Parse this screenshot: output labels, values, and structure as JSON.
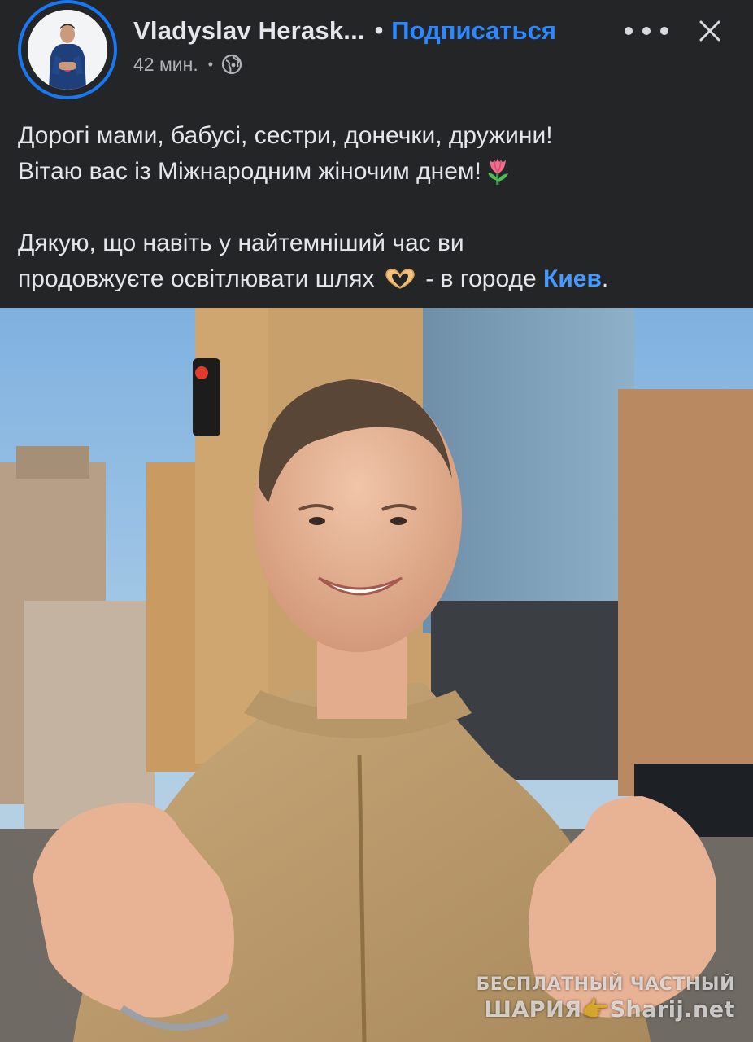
{
  "post": {
    "author": "Vladyslav Herask...",
    "follow_label": "Подписаться",
    "separator": "•",
    "time": "42 мин.",
    "meta_separator": "•",
    "privacy_icon": "globe-icon",
    "more_icon": "more-horizontal-icon",
    "close_icon": "close-icon"
  },
  "text": {
    "line1": "Дорогі мами, бабусі, сестри, донечки, дружини!",
    "line2": "Вітаю вас із Міжнародним жіночим днем!",
    "line3": "Дякую, що навіть у найтемніший час ви",
    "line4_prefix": "продовжуєте освітлювати шлях",
    "line4_suffix": "- в городе",
    "place": "Киев",
    "line4_end": "."
  },
  "watermark": {
    "line1": "БЕСПЛАТНЫЙ ЧАСТНЫЙ",
    "line2": "ШАРИЯ👉Sharij.net"
  },
  "colors": {
    "background": "#242526",
    "accent": "#2d88ff",
    "text": "#e4e6eb",
    "secondary_text": "#b0b3b8"
  }
}
